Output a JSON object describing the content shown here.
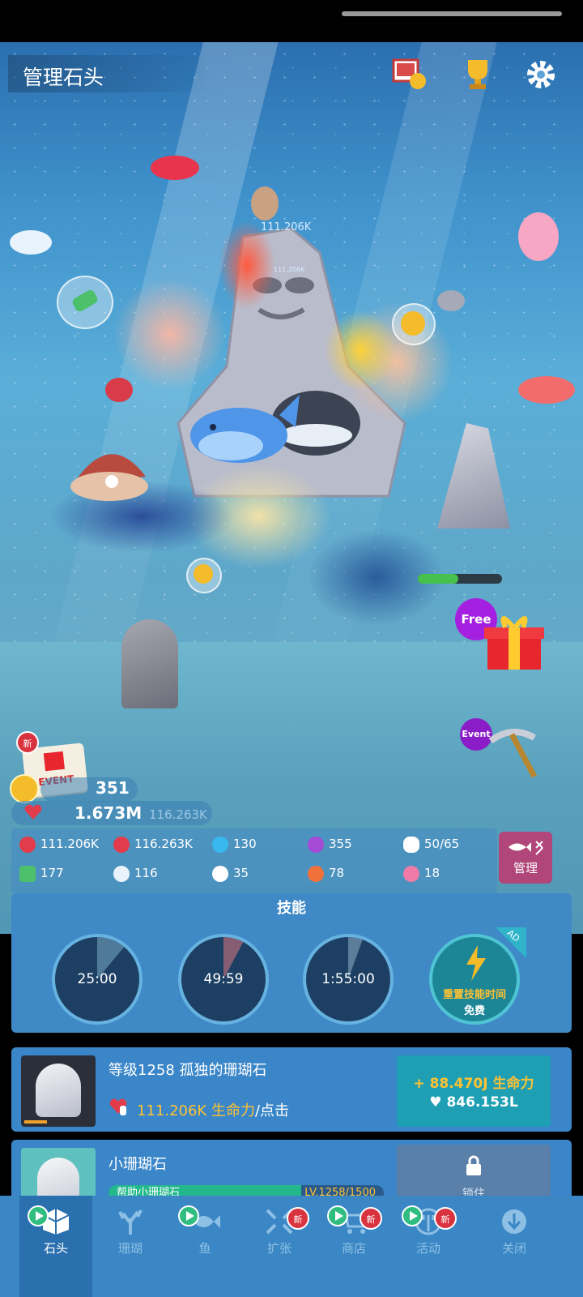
{
  "header": {
    "title": "管理石头"
  },
  "scene": {
    "floating_value_1": "111.206K",
    "floating_value_2": "111.206K",
    "free_badge": "Free",
    "event_badge": "Event",
    "event_calendar_label": "EVENT",
    "new_badge": "新"
  },
  "currency": {
    "coins": "351"
  },
  "life": {
    "value": "1.673M",
    "secondary": "116.263K"
  },
  "stats": {
    "per_tap": "111.206K",
    "per_sec": "116.263K",
    "gems": "130",
    "pearls": "355",
    "fish": "50/65",
    "plants": "177",
    "shells": "116",
    "urchins": "35",
    "crabs": "78",
    "seahorses": "18",
    "manage_label": "管理"
  },
  "skills": {
    "title": "技能",
    "timers": [
      "25:00",
      "49:59",
      "1:55:00"
    ],
    "reset_label": "重置技能时间",
    "reset_sub": "免费",
    "ad_tag": "AD"
  },
  "stone_row": {
    "title": "等级1258 孤独的珊瑚石",
    "rate_value": "111.206K 生命力",
    "rate_suffix": "/点击",
    "upgrade_gain": "+ 88.470J 生命力",
    "upgrade_cost": "846.153L"
  },
  "small_row": {
    "title": "小珊瑚石",
    "progress_label": "帮助小珊瑚石",
    "progress_value": "LV.1258/1500",
    "locked_label": "锁住"
  },
  "nav": {
    "items": [
      "石头",
      "珊瑚",
      "鱼",
      "扩张",
      "商店",
      "活动",
      "关闭"
    ],
    "active": "石头",
    "new_label": "新"
  },
  "colors": {
    "accent": "#3b87c5",
    "gold": "#ffc233",
    "manage": "#b0467a",
    "upgrade": "#1f9fb4"
  }
}
